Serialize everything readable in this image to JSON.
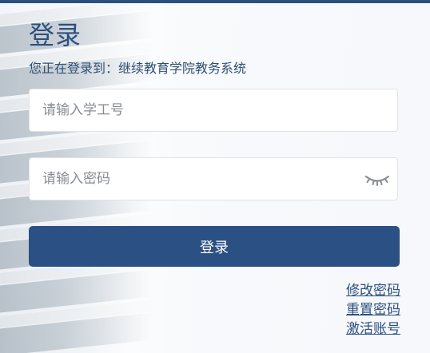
{
  "login": {
    "title": "登录",
    "subtitle": "您正在登录到：继续教育学院教务系统",
    "username_placeholder": "请输入学工号",
    "password_placeholder": "请输入密码",
    "submit_label": "登录"
  },
  "links": {
    "change_password": "修改密码",
    "reset_password": "重置密码",
    "activate_account": "激活账号"
  },
  "icons": {
    "password_toggle": "eye-closed-icon"
  },
  "colors": {
    "primary": "#2b5083",
    "title": "#2d4f7c",
    "top_bar": "#2c4f7e",
    "placeholder": "#888c91"
  }
}
